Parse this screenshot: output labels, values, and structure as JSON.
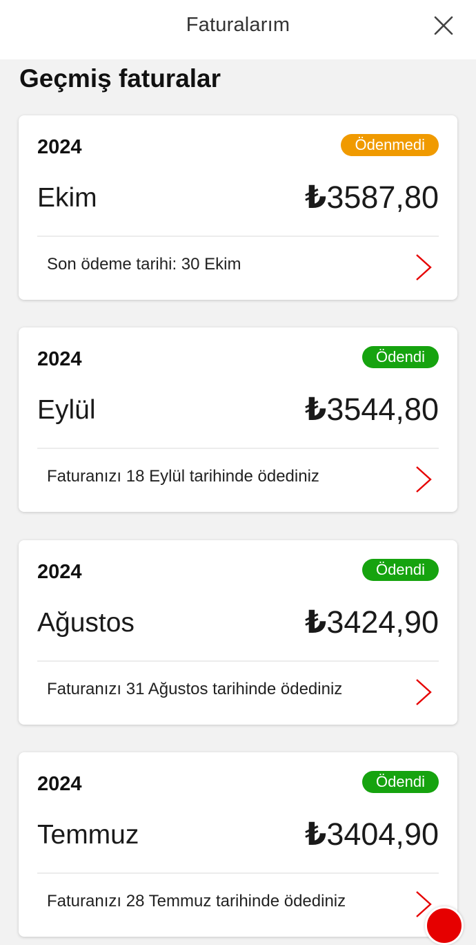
{
  "header": {
    "title": "Faturalarım"
  },
  "section": {
    "title": "Geçmiş faturalar"
  },
  "colors": {
    "unpaid_badge": "#f09a00",
    "paid_badge": "#16a30f",
    "chevron": "#e60000",
    "accent": "#e60000"
  },
  "bills": [
    {
      "year": "2024",
      "status": "Ödenmedi",
      "status_type": "unpaid",
      "month": "Ekim",
      "currency_symbol": "₺",
      "amount": "3587,80",
      "note": "Son ödeme tarihi: 30 Ekim"
    },
    {
      "year": "2024",
      "status": "Ödendi",
      "status_type": "paid",
      "month": "Eylül",
      "currency_symbol": "₺",
      "amount": "3544,80",
      "note": "Faturanızı 18 Eylül tarihinde ödediniz"
    },
    {
      "year": "2024",
      "status": "Ödendi",
      "status_type": "paid",
      "month": "Ağustos",
      "currency_symbol": "₺",
      "amount": "3424,90",
      "note": "Faturanızı 31 Ağustos tarihinde ödediniz"
    },
    {
      "year": "2024",
      "status": "Ödendi",
      "status_type": "paid",
      "month": "Temmuz",
      "currency_symbol": "₺",
      "amount": "3404,90",
      "note": "Faturanızı 28 Temmuz tarihinde ödediniz"
    }
  ],
  "icons": {
    "close": "close-icon",
    "chevron": "chevron-right-icon",
    "brand": "brand-logo-icon"
  }
}
